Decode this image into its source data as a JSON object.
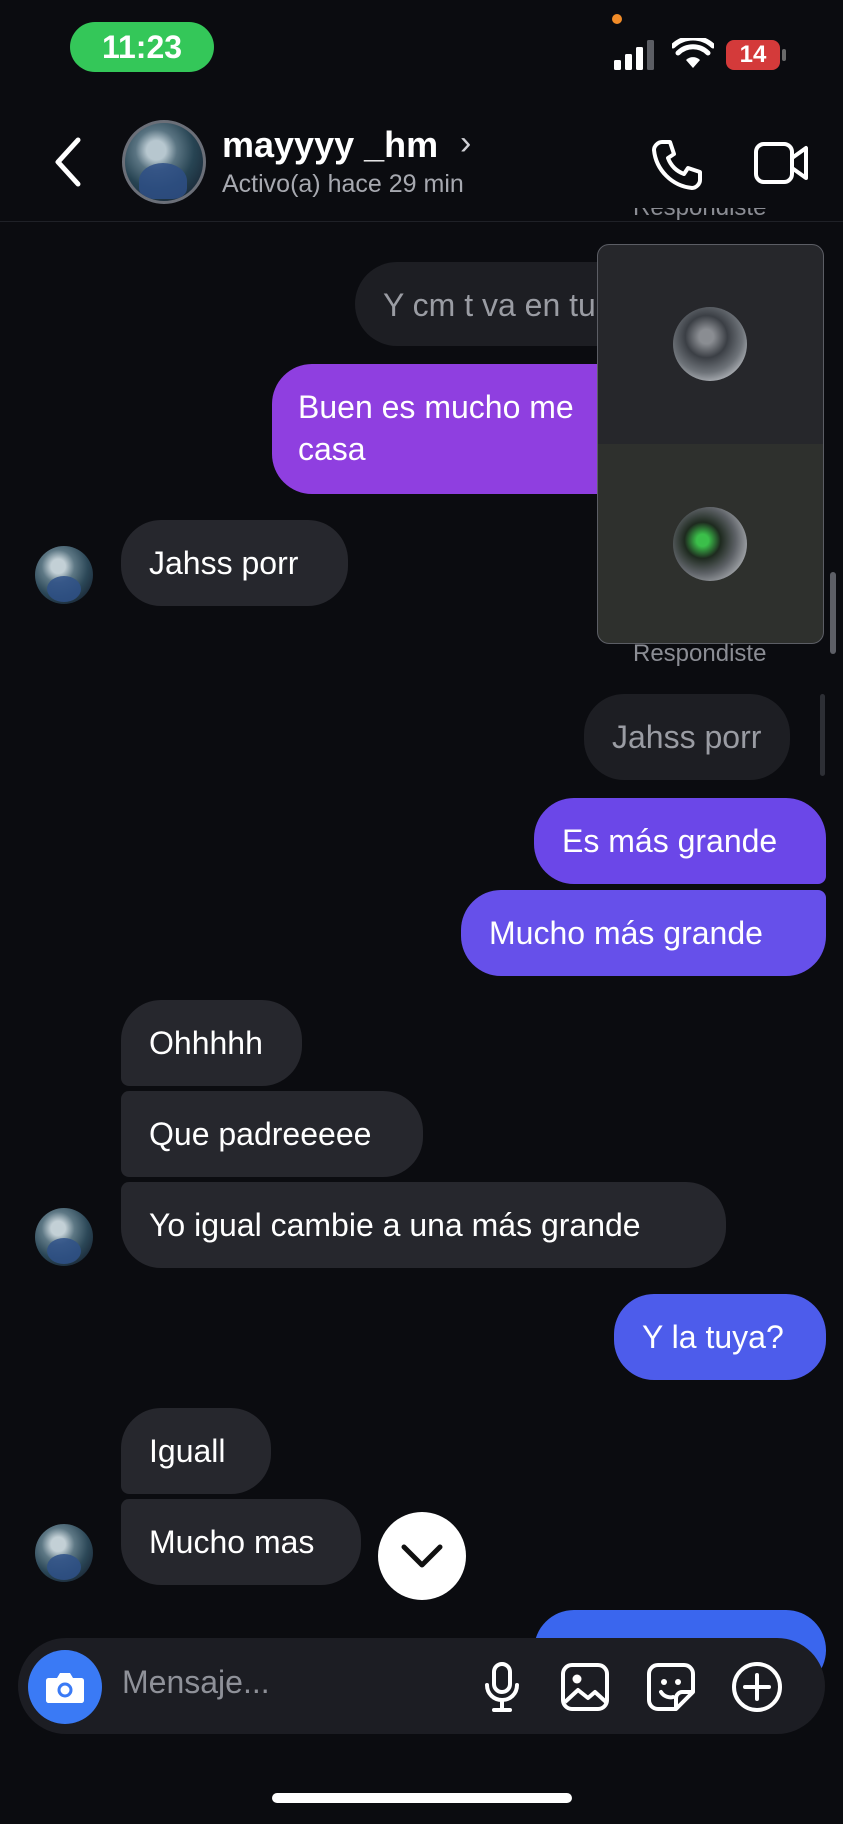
{
  "status_bar": {
    "time": "11:23",
    "battery": "14"
  },
  "header": {
    "username": "mayyyy _hm",
    "activity": "Activo(a) hace 29 min"
  },
  "story_overlay": {
    "label_top": "Respondiste",
    "label_bottom": "Respondiste"
  },
  "messages": {
    "quoted_top": "Y cm t va en tu",
    "out_1": "Buen es mucho me",
    "out_1b": "casa",
    "in_1": "Jahss porr",
    "quoted_reply": "Jahss porr",
    "out_2": "Es más grande",
    "out_3": "Mucho más grande",
    "in_2": "Ohhhhh",
    "in_3": "Que padreeeee",
    "in_4": "Yo igual cambie a una más grande",
    "out_4": "Y la tuya?",
    "in_5": "Iguall",
    "in_6": "Mucho mas"
  },
  "composer": {
    "placeholder": "Mensaje..."
  },
  "colors": {
    "accent_blue": "#3a7af5",
    "bubble_purple": "#8f3fe0",
    "bubble_violet": "#6b47e8",
    "bubble_blue": "#4d5ceb",
    "status_green": "#34c759"
  }
}
